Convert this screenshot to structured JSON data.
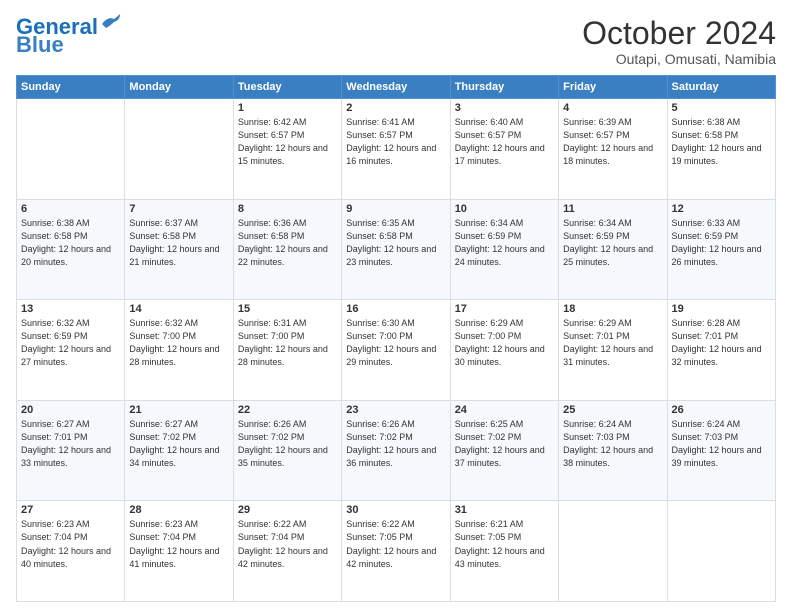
{
  "logo": {
    "line1": "General",
    "line2": "Blue"
  },
  "title": "October 2024",
  "location": "Outapi, Omusati, Namibia",
  "days_of_week": [
    "Sunday",
    "Monday",
    "Tuesday",
    "Wednesday",
    "Thursday",
    "Friday",
    "Saturday"
  ],
  "weeks": [
    [
      {
        "day": "",
        "info": ""
      },
      {
        "day": "",
        "info": ""
      },
      {
        "day": "1",
        "info": "Sunrise: 6:42 AM\nSunset: 6:57 PM\nDaylight: 12 hours and 15 minutes."
      },
      {
        "day": "2",
        "info": "Sunrise: 6:41 AM\nSunset: 6:57 PM\nDaylight: 12 hours and 16 minutes."
      },
      {
        "day": "3",
        "info": "Sunrise: 6:40 AM\nSunset: 6:57 PM\nDaylight: 12 hours and 17 minutes."
      },
      {
        "day": "4",
        "info": "Sunrise: 6:39 AM\nSunset: 6:57 PM\nDaylight: 12 hours and 18 minutes."
      },
      {
        "day": "5",
        "info": "Sunrise: 6:38 AM\nSunset: 6:58 PM\nDaylight: 12 hours and 19 minutes."
      }
    ],
    [
      {
        "day": "6",
        "info": "Sunrise: 6:38 AM\nSunset: 6:58 PM\nDaylight: 12 hours and 20 minutes."
      },
      {
        "day": "7",
        "info": "Sunrise: 6:37 AM\nSunset: 6:58 PM\nDaylight: 12 hours and 21 minutes."
      },
      {
        "day": "8",
        "info": "Sunrise: 6:36 AM\nSunset: 6:58 PM\nDaylight: 12 hours and 22 minutes."
      },
      {
        "day": "9",
        "info": "Sunrise: 6:35 AM\nSunset: 6:58 PM\nDaylight: 12 hours and 23 minutes."
      },
      {
        "day": "10",
        "info": "Sunrise: 6:34 AM\nSunset: 6:59 PM\nDaylight: 12 hours and 24 minutes."
      },
      {
        "day": "11",
        "info": "Sunrise: 6:34 AM\nSunset: 6:59 PM\nDaylight: 12 hours and 25 minutes."
      },
      {
        "day": "12",
        "info": "Sunrise: 6:33 AM\nSunset: 6:59 PM\nDaylight: 12 hours and 26 minutes."
      }
    ],
    [
      {
        "day": "13",
        "info": "Sunrise: 6:32 AM\nSunset: 6:59 PM\nDaylight: 12 hours and 27 minutes."
      },
      {
        "day": "14",
        "info": "Sunrise: 6:32 AM\nSunset: 7:00 PM\nDaylight: 12 hours and 28 minutes."
      },
      {
        "day": "15",
        "info": "Sunrise: 6:31 AM\nSunset: 7:00 PM\nDaylight: 12 hours and 28 minutes."
      },
      {
        "day": "16",
        "info": "Sunrise: 6:30 AM\nSunset: 7:00 PM\nDaylight: 12 hours and 29 minutes."
      },
      {
        "day": "17",
        "info": "Sunrise: 6:29 AM\nSunset: 7:00 PM\nDaylight: 12 hours and 30 minutes."
      },
      {
        "day": "18",
        "info": "Sunrise: 6:29 AM\nSunset: 7:01 PM\nDaylight: 12 hours and 31 minutes."
      },
      {
        "day": "19",
        "info": "Sunrise: 6:28 AM\nSunset: 7:01 PM\nDaylight: 12 hours and 32 minutes."
      }
    ],
    [
      {
        "day": "20",
        "info": "Sunrise: 6:27 AM\nSunset: 7:01 PM\nDaylight: 12 hours and 33 minutes."
      },
      {
        "day": "21",
        "info": "Sunrise: 6:27 AM\nSunset: 7:02 PM\nDaylight: 12 hours and 34 minutes."
      },
      {
        "day": "22",
        "info": "Sunrise: 6:26 AM\nSunset: 7:02 PM\nDaylight: 12 hours and 35 minutes."
      },
      {
        "day": "23",
        "info": "Sunrise: 6:26 AM\nSunset: 7:02 PM\nDaylight: 12 hours and 36 minutes."
      },
      {
        "day": "24",
        "info": "Sunrise: 6:25 AM\nSunset: 7:02 PM\nDaylight: 12 hours and 37 minutes."
      },
      {
        "day": "25",
        "info": "Sunrise: 6:24 AM\nSunset: 7:03 PM\nDaylight: 12 hours and 38 minutes."
      },
      {
        "day": "26",
        "info": "Sunrise: 6:24 AM\nSunset: 7:03 PM\nDaylight: 12 hours and 39 minutes."
      }
    ],
    [
      {
        "day": "27",
        "info": "Sunrise: 6:23 AM\nSunset: 7:04 PM\nDaylight: 12 hours and 40 minutes."
      },
      {
        "day": "28",
        "info": "Sunrise: 6:23 AM\nSunset: 7:04 PM\nDaylight: 12 hours and 41 minutes."
      },
      {
        "day": "29",
        "info": "Sunrise: 6:22 AM\nSunset: 7:04 PM\nDaylight: 12 hours and 42 minutes."
      },
      {
        "day": "30",
        "info": "Sunrise: 6:22 AM\nSunset: 7:05 PM\nDaylight: 12 hours and 42 minutes."
      },
      {
        "day": "31",
        "info": "Sunrise: 6:21 AM\nSunset: 7:05 PM\nDaylight: 12 hours and 43 minutes."
      },
      {
        "day": "",
        "info": ""
      },
      {
        "day": "",
        "info": ""
      }
    ]
  ]
}
